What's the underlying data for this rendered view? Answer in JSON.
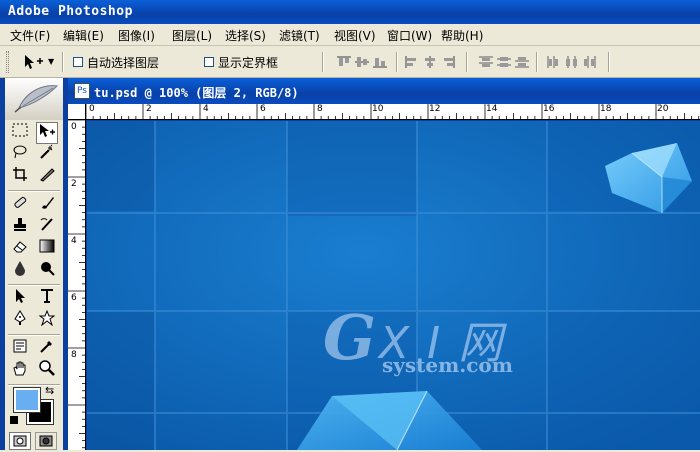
{
  "window": {
    "title": "Adobe Photoshop"
  },
  "menu": [
    "文件(F)",
    "编辑(E)",
    "图像(I)",
    "图层(L)",
    "选择(S)",
    "滤镜(T)",
    "视图(V)",
    "窗口(W)",
    "帮助(H)"
  ],
  "options": {
    "auto_select_layer": "自动选择图层",
    "auto_select_checked": false,
    "show_bounding_box": "显示定界框",
    "show_bounding_checked": false
  },
  "document": {
    "title": "tu.psd @ 100% (图层 2, RGB/8)",
    "zoom": "100%",
    "ruler_top": [
      "0",
      "2",
      "4",
      "6",
      "8",
      "10",
      "12",
      "14",
      "16",
      "18",
      "20"
    ],
    "ruler_left": [
      "0",
      "2",
      "4",
      "6",
      "8"
    ]
  },
  "colors": {
    "foreground": "#69aef0",
    "background": "#000000",
    "canvas_blue": "#0a62b0",
    "titlebar_blue": "#0841a8"
  },
  "watermark": {
    "g": "G",
    "xi": "X I 网",
    "domain": "system.com"
  }
}
